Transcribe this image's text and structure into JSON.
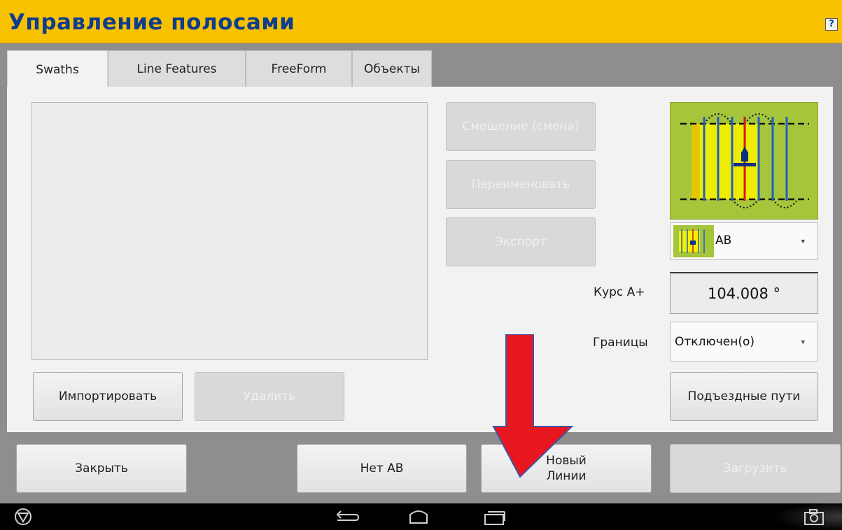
{
  "window": {
    "title": "Управление полосами",
    "help_label": "?"
  },
  "tabs": [
    {
      "label": "Swaths",
      "active": true
    },
    {
      "label": "Line Features",
      "active": false
    },
    {
      "label": "FreeForm",
      "active": false
    },
    {
      "label": "Объекты",
      "active": false
    }
  ],
  "actions": {
    "shift": "Смещение (смена)",
    "rename": "Переименовать",
    "export": "Экспорт",
    "import": "Импортировать",
    "delete": "Удалить"
  },
  "pattern": {
    "selected": "AB"
  },
  "course": {
    "label": "Курс A+",
    "value": "104.008 °"
  },
  "boundaries": {
    "label": "Границы",
    "selected": "Отключен(о)"
  },
  "headland_button": "Подъездные пути",
  "footer": {
    "close": "Закрыть",
    "no_ab": "Нет АВ",
    "new_lines_line1": "Новый",
    "new_lines_line2": "Линии",
    "load": "Загрузить"
  },
  "colors": {
    "title_bar": "#f9c200",
    "title_text": "#0d3d8f",
    "annotation_arrow": "#e8161f",
    "preview_bg": "#a6c53a"
  },
  "icons": [
    "trimble-logo-icon",
    "back-icon",
    "home-icon",
    "recent-apps-icon",
    "screenshot-camera-icon",
    "help-icon",
    "chevron-down-icon"
  ]
}
